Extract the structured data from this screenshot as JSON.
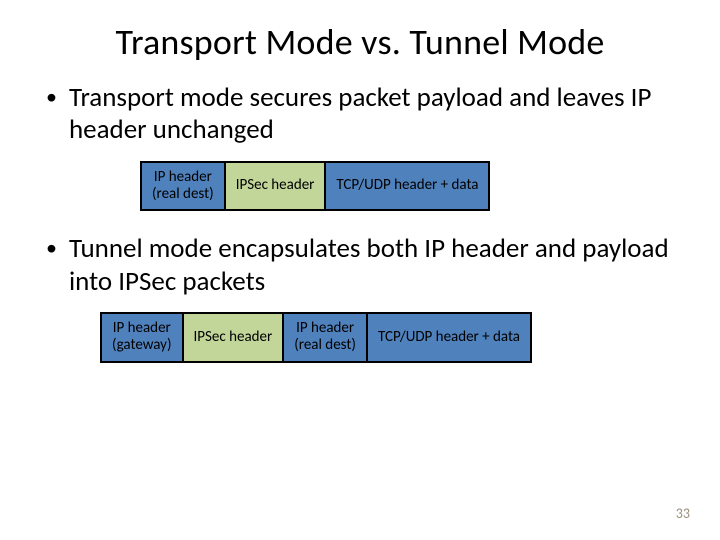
{
  "title": "Transport Mode vs. Tunnel Mode",
  "bullets": {
    "b1": "Transport mode secures packet payload and leaves IP header unchanged",
    "b2": "Tunnel mode encapsulates both IP header and payload into IPSec packets"
  },
  "packets": {
    "transport": {
      "seg1_l1": "IP header",
      "seg1_l2": "(real dest)",
      "seg2": "IPSec header",
      "seg3": "TCP/UDP header + data"
    },
    "tunnel": {
      "seg1_l1": "IP header",
      "seg1_l2": "(gateway)",
      "seg2": "IPSec header",
      "seg3_l1": "IP header",
      "seg3_l2": "(real dest)",
      "seg4": "TCP/UDP header + data"
    }
  },
  "page_number": "33",
  "colors": {
    "block_blue": "#4f81bd",
    "block_olive": "#c2d69a"
  }
}
